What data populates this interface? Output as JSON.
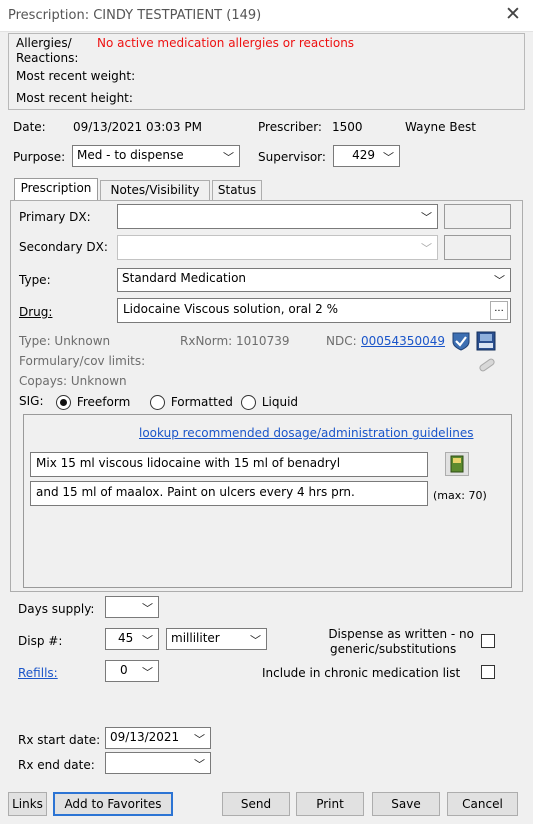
{
  "window": {
    "title": "Prescription: CINDY TESTPATIENT (149)"
  },
  "patient_info": {
    "allergies_label": "Allergies/",
    "reactions_label": "Reactions:",
    "allergies_value": "No active medication allergies or reactions",
    "weight_label": "Most recent weight:",
    "height_label": "Most recent height:"
  },
  "header": {
    "date_label": "Date:",
    "date_value": "09/13/2021 03:03 PM",
    "prescriber_label": "Prescriber:",
    "prescriber_id": "1500",
    "prescriber_name": "Wayne Best",
    "purpose_label": "Purpose:",
    "purpose_value": "Med - to dispense",
    "supervisor_label": "Supervisor:",
    "supervisor_value": "429"
  },
  "tabs": [
    {
      "label": "Prescription",
      "active": true
    },
    {
      "label": "Notes/Visibility",
      "active": false
    },
    {
      "label": "Status",
      "active": false
    }
  ],
  "prescription": {
    "primary_dx_label": "Primary DX:",
    "primary_dx_value": "",
    "secondary_dx_label": "Secondary DX:",
    "secondary_dx_value": "",
    "type_label": "Type:",
    "type_value": "Standard Medication",
    "drug_label": "Drug:",
    "drug_value": "Lidocaine Viscous solution, oral 2 %",
    "drug_browse": "...",
    "info_type": "Type:  Unknown",
    "rxnorm": "RxNorm:  1010739",
    "ndc_label": "NDC:",
    "ndc_value": "00054350049",
    "formulary": "Formulary/cov limits:",
    "copays": "Copays:  Unknown",
    "sig_label": "SIG:",
    "sig_options": [
      "Freeform",
      "Formatted",
      "Liquid"
    ],
    "sig_selected": "Freeform",
    "lookup_link": "lookup recommended dosage/administration guidelines",
    "sig_line1": "Mix 15 ml viscous lidocaine with 15 ml of benadryl",
    "sig_line2": "and 15 ml of maalox. Paint on ulcers every 4 hrs prn.",
    "sig_max": "(max: 70)"
  },
  "dispense": {
    "days_supply_label": "Days supply:",
    "days_supply_value": "",
    "disp_label": "Disp #:",
    "disp_value": "45",
    "disp_unit": "milliliter",
    "refills_label": "Refills:",
    "refills_value": "0",
    "daw_label_line1": "Dispense as written - no",
    "daw_label_line2": "generic/substitutions",
    "chronic_label": "Include in chronic medication list",
    "start_label": "Rx start date:",
    "start_value": "09/13/2021",
    "end_label": "Rx end date:",
    "end_value": ""
  },
  "buttons": {
    "links": "Links",
    "favorites": "Add to Favorites",
    "send": "Send",
    "print": "Print",
    "save": "Save",
    "cancel": "Cancel"
  },
  "colors": {
    "allergy_text": "#ee1111",
    "link": "#1a55c9",
    "default_button_border": "#2c74d4"
  }
}
